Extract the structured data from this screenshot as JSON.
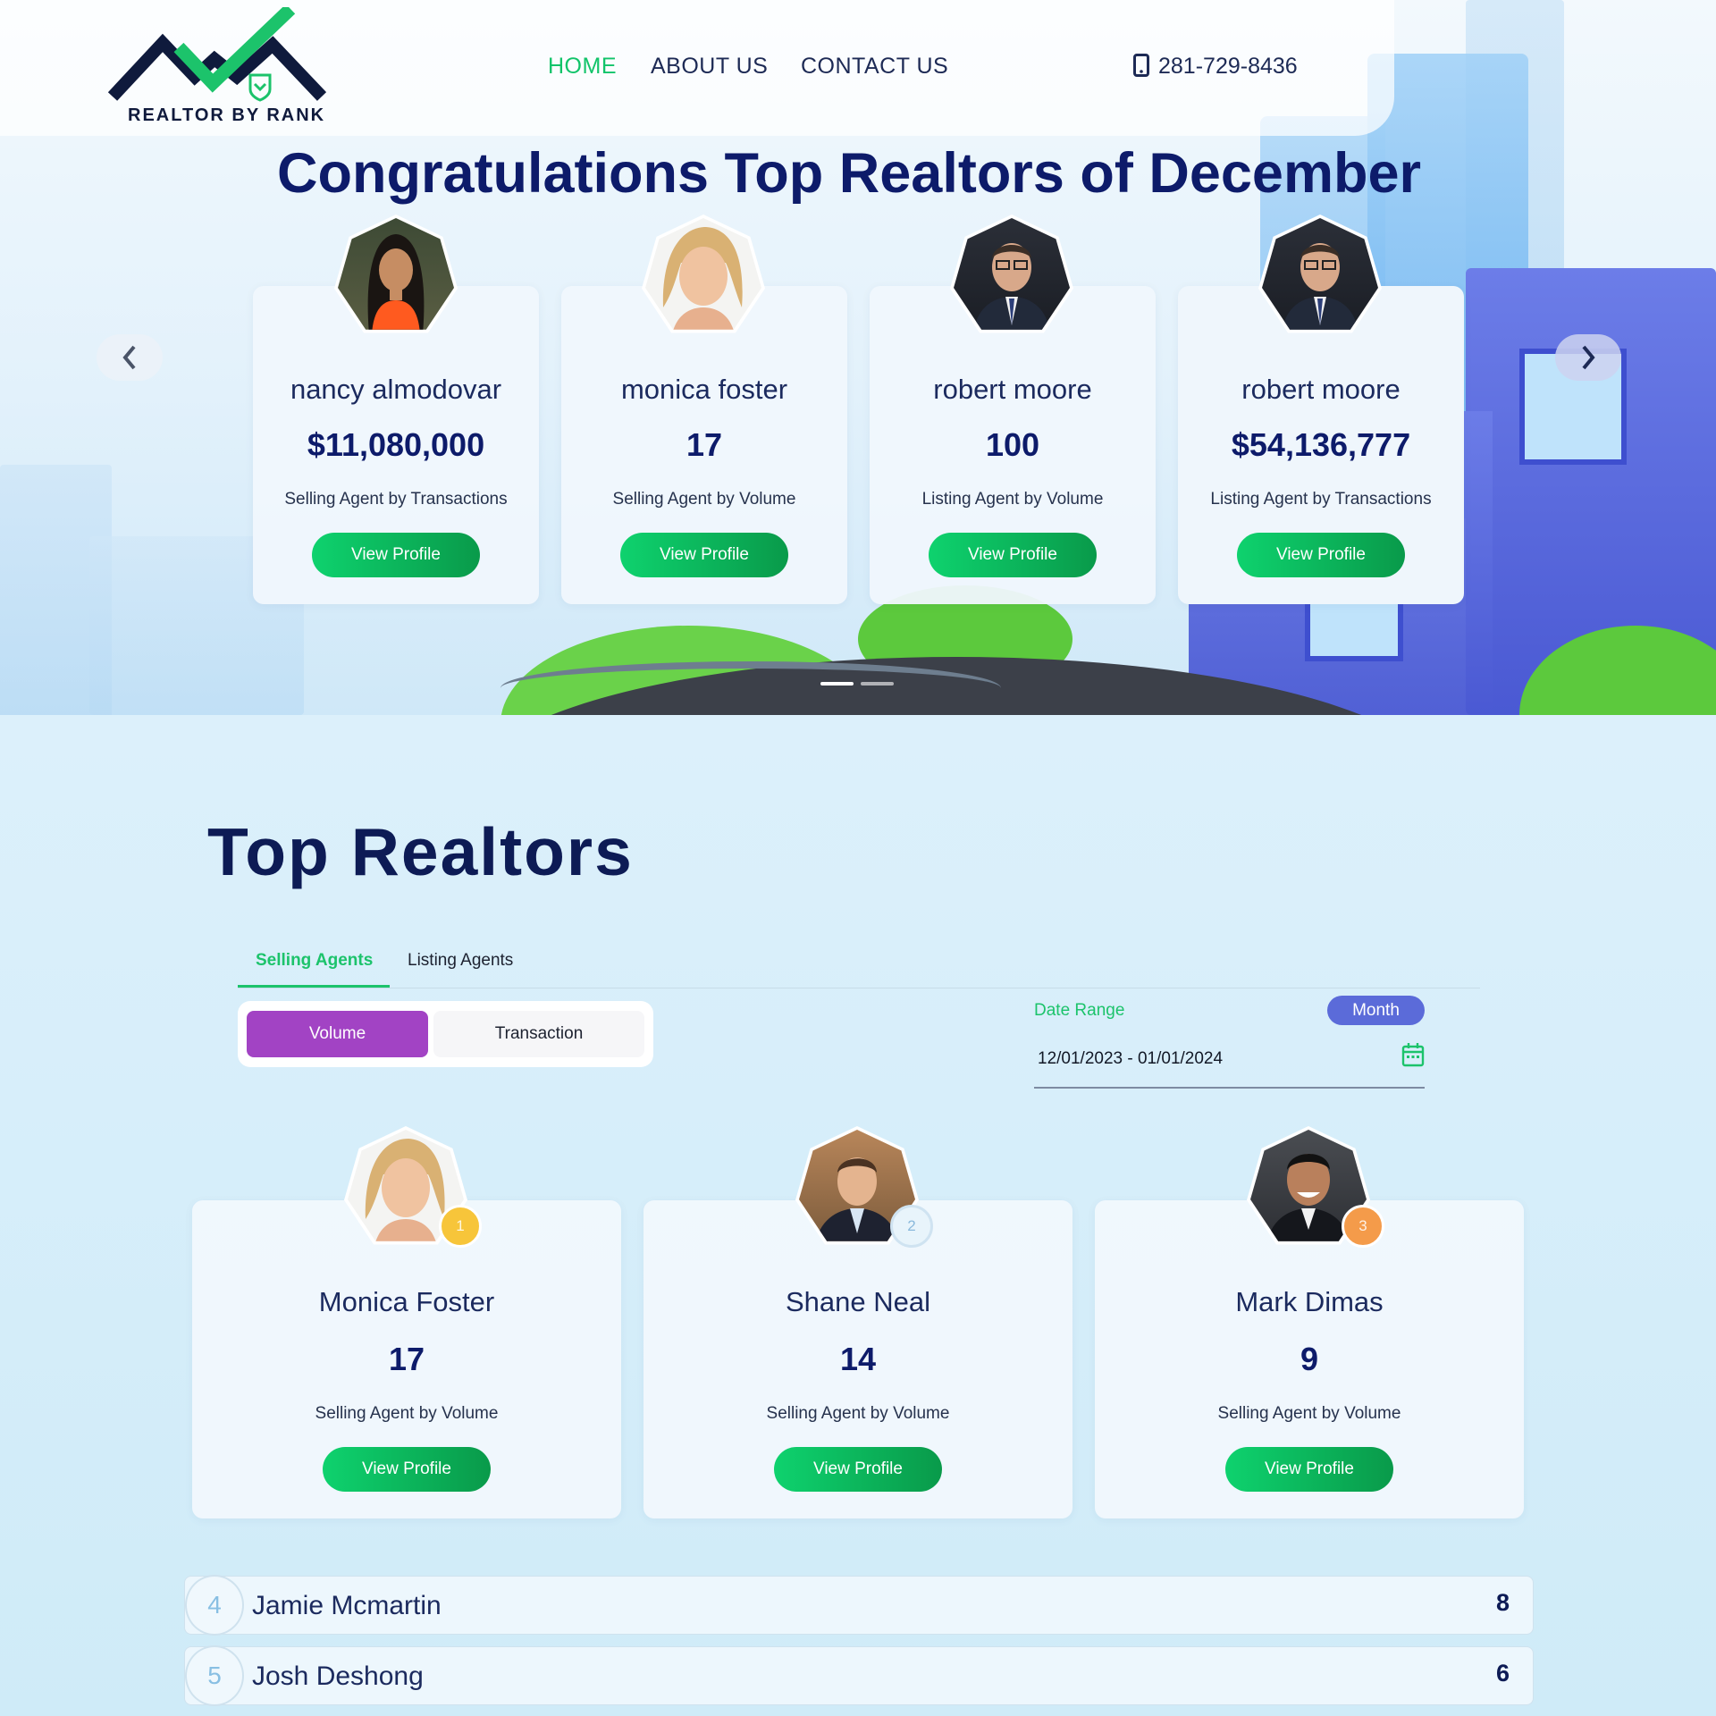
{
  "brand": {
    "name": "REALTOR BY RANK",
    "colors": {
      "navy": "#0d1b6a",
      "green": "#12c46a",
      "purple": "#a243c4",
      "periwinkle": "#5b6bd9"
    }
  },
  "nav": {
    "items": [
      {
        "label": "HOME",
        "active": true
      },
      {
        "label": "ABOUT US"
      },
      {
        "label": "CONTACT US"
      }
    ],
    "phone": "281-729-8436",
    "phone_icon": "mobile-phone-icon"
  },
  "hero": {
    "title": "Congratulations Top Realtors of December",
    "cards": [
      {
        "name": "nancy almodovar",
        "value": "$11,080,000",
        "category": "Selling Agent by Transactions",
        "button": "View Profile"
      },
      {
        "name": "monica foster",
        "value": "17",
        "category": "Selling Agent by Volume",
        "button": "View Profile"
      },
      {
        "name": "robert moore",
        "value": "100",
        "category": "Listing Agent by Volume",
        "button": "View Profile"
      },
      {
        "name": "robert moore",
        "value": "$54,136,777",
        "category": "Listing Agent by Transactions",
        "button": "View Profile"
      }
    ],
    "prev_icon": "chevron-left-icon",
    "next_icon": "chevron-right-icon",
    "slides": 2,
    "active_slide": 1
  },
  "top": {
    "title": "Top Realtors",
    "tabs": [
      {
        "label": "Selling Agents",
        "active": true
      },
      {
        "label": "Listing Agents"
      }
    ],
    "toggle": {
      "on": "Volume",
      "off": "Transaction"
    },
    "date_range": {
      "label": "Date Range",
      "period": "Month",
      "value": "12/01/2023 - 01/01/2024",
      "icon": "calendar-icon"
    },
    "podium": [
      {
        "rank": "1",
        "name": "Monica Foster",
        "value": "17",
        "category": "Selling Agent by Volume",
        "button": "View Profile",
        "badge_color": "#f7c53a"
      },
      {
        "rank": "2",
        "name": "Shane Neal",
        "value": "14",
        "category": "Selling Agent by Volume",
        "button": "View Profile",
        "badge_color": "#e8f4fb"
      },
      {
        "rank": "3",
        "name": "Mark Dimas",
        "value": "9",
        "category": "Selling Agent by Volume",
        "button": "View Profile",
        "badge_color": "#f49b4a"
      }
    ],
    "list": [
      {
        "rank": "4",
        "name": "Jamie Mcmartin",
        "value": "8"
      },
      {
        "rank": "5",
        "name": "Josh Deshong",
        "value": "6"
      }
    ]
  }
}
